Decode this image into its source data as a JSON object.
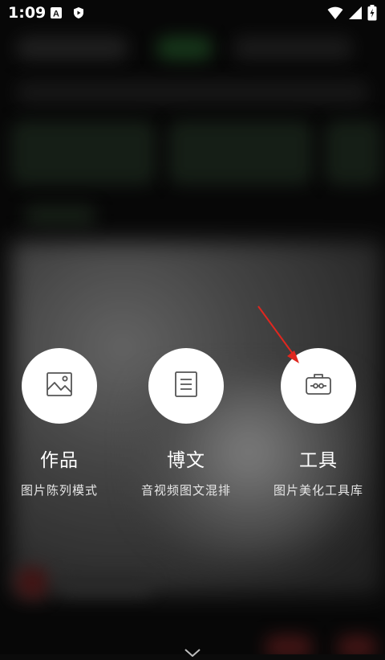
{
  "status_bar": {
    "time": "1:09",
    "icons": [
      "notification-a-icon",
      "shield-play-icon",
      "wifi-icon",
      "cellular-signal-icon",
      "battery-charging-icon"
    ]
  },
  "actions": [
    {
      "id": "works",
      "icon": "image-icon",
      "title": "作品",
      "subtitle": "图片陈列模式"
    },
    {
      "id": "article",
      "icon": "document-icon",
      "title": "博文",
      "subtitle": "音视频图文混排"
    },
    {
      "id": "tools",
      "icon": "toolbox-icon",
      "title": "工具",
      "subtitle": "图片美化工具库"
    }
  ],
  "colors": {
    "overlay": "#0b0b0b",
    "circle": "#ffffff",
    "icon_stroke": "#555555",
    "arrow": "#e0271f"
  },
  "bottom": {
    "icon": "chevron-down-icon"
  }
}
